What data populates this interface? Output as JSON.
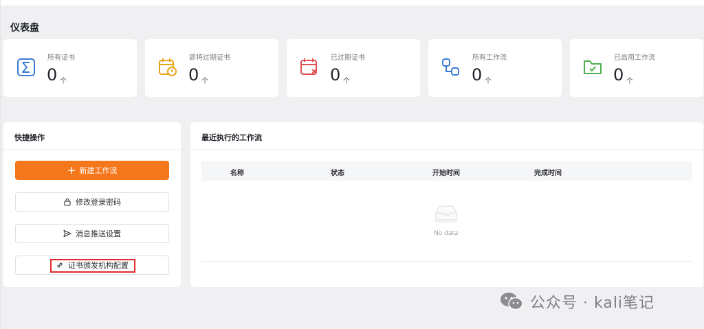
{
  "page_title": "仪表盘",
  "stats": [
    {
      "label": "所有证书",
      "value": "0",
      "unit": "个",
      "icon": "sigma-icon",
      "color": "#3a7bd5"
    },
    {
      "label": "即将过期证书",
      "value": "0",
      "unit": "个",
      "icon": "calendar-clock-icon",
      "color": "#e8a317"
    },
    {
      "label": "已过期证书",
      "value": "0",
      "unit": "个",
      "icon": "calendar-x-icon",
      "color": "#e05050"
    },
    {
      "label": "所有工作流",
      "value": "0",
      "unit": "个",
      "icon": "workflow-icon",
      "color": "#3a7bd5"
    },
    {
      "label": "已启用工作流",
      "value": "0",
      "unit": "个",
      "icon": "folder-check-icon",
      "color": "#4caf50"
    }
  ],
  "quick_actions": {
    "title": "快捷操作",
    "buttons": [
      {
        "label": "新建工作流",
        "icon": "plus-icon"
      },
      {
        "label": "修改登录密码",
        "icon": "lock-icon"
      },
      {
        "label": "消息推送设置",
        "icon": "send-icon"
      },
      {
        "label": "证书颁发机构配置",
        "icon": "link-icon"
      }
    ]
  },
  "recent_workflows": {
    "title": "最近执行的工作流",
    "columns": [
      "名称",
      "状态",
      "开始时间",
      "完成时间"
    ],
    "empty_text": "No data"
  },
  "watermark": "公众号 · kali笔记",
  "colors": {
    "accent": "#f5771c",
    "highlight": "#e02a2a"
  }
}
